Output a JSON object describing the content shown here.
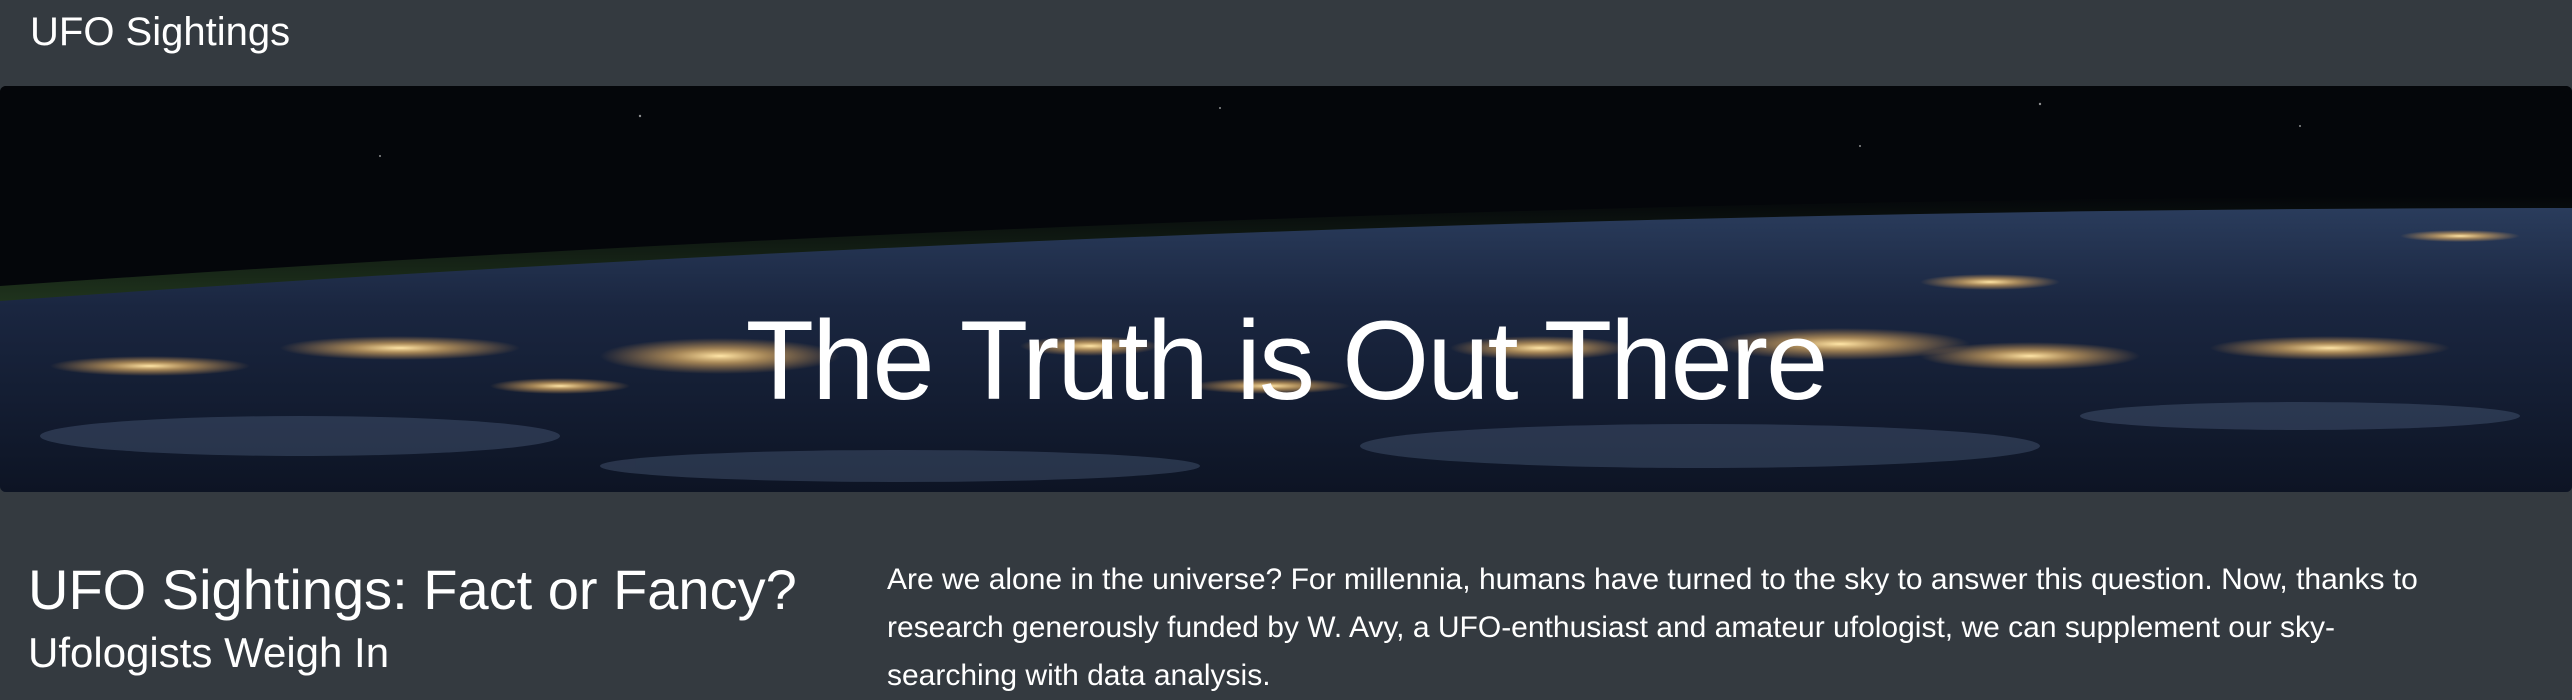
{
  "navbar": {
    "brand": "UFO Sightings"
  },
  "hero": {
    "title": "The Truth is Out There",
    "image": "earth-at-night-from-space"
  },
  "main": {
    "heading": "UFO Sightings: Fact or Fancy?",
    "subheading": "Ufologists Weigh In",
    "intro": "Are we alone in the universe? For millennia, humans have turned to the sky to answer this question. Now, thanks to research generously funded by W. Avy, a UFO-enthusiast and amateur ufologist, we can supplement our sky-searching with data analysis."
  },
  "colors": {
    "page_background": "#343a40",
    "text": "#ffffff",
    "city_lights": "#ffd27a",
    "atmosphere": "#4a7a3a"
  }
}
